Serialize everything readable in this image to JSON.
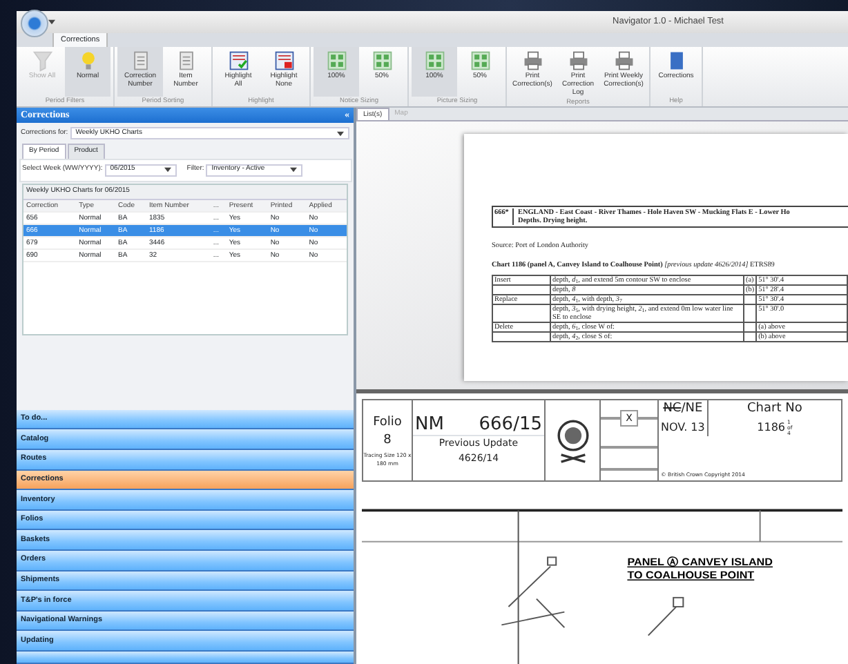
{
  "window": {
    "title": "Navigator 1.0 - Michael Test"
  },
  "ribbon": {
    "tabs": [
      {
        "label": "Corrections",
        "selected": true
      }
    ],
    "groups": [
      {
        "label": "Period Filters",
        "buttons": [
          {
            "label": "Show All",
            "kind": "funnel",
            "selected": false,
            "disabled": true
          },
          {
            "label": "Normal",
            "kind": "bulb",
            "selected": true,
            "disabled": false
          }
        ]
      },
      {
        "label": "Period Sorting",
        "buttons": [
          {
            "label": "Correction Number",
            "kind": "doc",
            "selected": true,
            "disabled": false
          },
          {
            "label": "Item Number",
            "kind": "doc",
            "selected": false,
            "disabled": false
          }
        ]
      },
      {
        "label": "Highlight",
        "buttons": [
          {
            "label": "Highlight All",
            "kind": "check",
            "selected": false,
            "disabled": false
          },
          {
            "label": "Highlight None",
            "kind": "cross",
            "selected": false,
            "disabled": false
          }
        ]
      },
      {
        "label": "Notice Sizing",
        "buttons": [
          {
            "label": "100%",
            "kind": "grid",
            "selected": true,
            "disabled": false
          },
          {
            "label": "50%",
            "kind": "grid",
            "selected": false,
            "disabled": false
          }
        ]
      },
      {
        "label": "Picture Sizing",
        "buttons": [
          {
            "label": "100%",
            "kind": "grid",
            "selected": true,
            "disabled": false
          },
          {
            "label": "50%",
            "kind": "grid",
            "selected": false,
            "disabled": false
          }
        ]
      },
      {
        "label": "Reports",
        "buttons": [
          {
            "label": "Print Correction(s)",
            "kind": "printer",
            "selected": false,
            "disabled": false
          },
          {
            "label": "Print Correction Log",
            "kind": "printer",
            "selected": false,
            "disabled": false
          },
          {
            "label": "Print Weekly Correction(s)",
            "kind": "printer",
            "selected": false,
            "disabled": false
          }
        ]
      },
      {
        "label": "Help",
        "buttons": [
          {
            "label": "Corrections",
            "kind": "help",
            "selected": false,
            "disabled": false
          }
        ]
      }
    ]
  },
  "corrections_panel": {
    "title": "Corrections",
    "collapse_glyph": "«",
    "corrections_for": {
      "label": "Corrections for:",
      "value": "Weekly UKHO Charts"
    },
    "tabs": [
      {
        "label": "By Period",
        "selected": true
      },
      {
        "label": "Product",
        "selected": false
      }
    ],
    "select_week": {
      "label": "Select Week (WW/YYYY):",
      "value": "06/2015"
    },
    "filter": {
      "label": "Filter:",
      "value": "Inventory - Active"
    },
    "grid": {
      "caption": "Weekly UKHO Charts for 06/2015",
      "columns": [
        "Correction",
        "Type",
        "Code",
        "Item Number",
        "...",
        "Present",
        "Printed",
        "Applied"
      ],
      "rows": [
        {
          "cells": [
            "656",
            "Normal",
            "BA",
            "1835",
            "...",
            "Yes",
            "No",
            "No"
          ],
          "selected": false
        },
        {
          "cells": [
            "666",
            "Normal",
            "BA",
            "1186",
            "...",
            "Yes",
            "No",
            "No"
          ],
          "selected": true
        },
        {
          "cells": [
            "679",
            "Normal",
            "BA",
            "3446",
            "...",
            "Yes",
            "No",
            "No"
          ],
          "selected": false
        },
        {
          "cells": [
            "690",
            "Normal",
            "BA",
            "32",
            "...",
            "Yes",
            "No",
            "No"
          ],
          "selected": false
        }
      ]
    }
  },
  "navigation": {
    "items": [
      {
        "label": "To do...",
        "selected": false
      },
      {
        "label": "Catalog",
        "selected": false
      },
      {
        "label": "Routes",
        "selected": false
      },
      {
        "label": "Corrections",
        "selected": true
      },
      {
        "label": "Inventory",
        "selected": false
      },
      {
        "label": "Folios",
        "selected": false
      },
      {
        "label": "Baskets",
        "selected": false
      },
      {
        "label": "Orders",
        "selected": false
      },
      {
        "label": "Shipments",
        "selected": false
      },
      {
        "label": "T&P's in force",
        "selected": false
      },
      {
        "label": "Navigational Warnings",
        "selected": false
      },
      {
        "label": "Updating",
        "selected": false
      }
    ]
  },
  "view_tabs": [
    {
      "label": "List(s)",
      "selected": true
    },
    {
      "label": "Map",
      "selected": false
    }
  ],
  "notice": {
    "number": "666*",
    "heading": "ENGLAND - East Coast - River Thames - Hole Haven SW - Mucking Flats E - Lower Ho",
    "subheading": "Depths. Drying height.",
    "source": "Source: Port of London Authority",
    "chart_line": "**Chart 1186 (panel A, Canvey Island to Coalhouse Point)** *[previous update 4626/2014]* ETRS89",
    "rows": [
      {
        "action": "Insert",
        "text": "depth, *d*$_{1}$, and extend 5m contour SW to enclose",
        "ref": "(a)",
        "position": "51° 30'.4"
      },
      {
        "action": "",
        "text": "depth, *8*",
        "ref": "(b)",
        "position": "51° 28'.4"
      },
      {
        "action": "Replace",
        "text": "depth, *4*$_{1}$, with depth, *3*$_{7}$",
        "ref": "",
        "position": "51° 30'.4"
      },
      {
        "action": "",
        "text": "depth, *3*$_{5}$, with drying height, *2*$_{1}$, and extend 0m low water line SE to enclose",
        "ref": "",
        "position": "51° 30'.0"
      },
      {
        "action": "Delete",
        "text": "depth, *6*$_{1}$, close W of:",
        "ref": "",
        "position": "(a) above"
      },
      {
        "action": "",
        "text": "depth, *4*$_{2}$, close S of:",
        "ref": "",
        "position": "(b) above"
      }
    ]
  },
  "chart_block": {
    "folio_label": "Folio",
    "folio": "8",
    "tracing_size": "Tracing Size 120 x 180 mm",
    "nm_label": "NM",
    "nm_number": "666/15",
    "previous_update_label": "Previous Update",
    "previous_update": "4626/14",
    "grid_mark": "X",
    "struck_code": "NC",
    "code_rest": "/NE",
    "date": "NOV. 13",
    "copyright": "© British Crown Copyright 2014",
    "chart_no_label": "Chart No",
    "chart_no": "1186",
    "sheet": "1",
    "sheet_of": "of",
    "sheet_total": "4",
    "panel_title_1": "PANEL Ⓐ CANVEY ISLAND",
    "panel_title_2": "TO COALHOUSE POINT"
  }
}
